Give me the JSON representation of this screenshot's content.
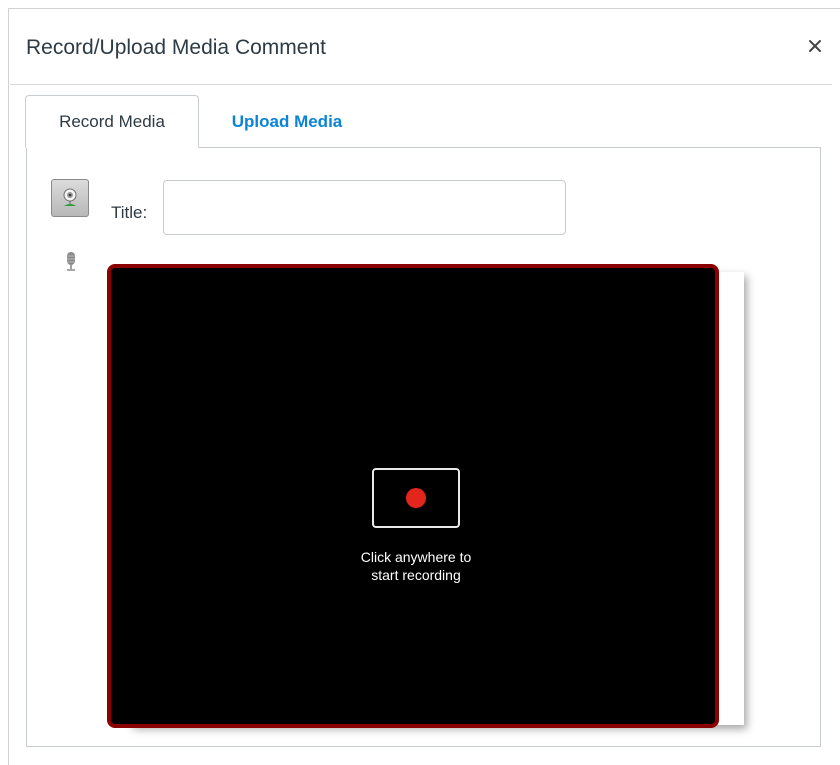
{
  "dialog": {
    "title": "Record/Upload Media Comment",
    "close_label": "×",
    "colors": {
      "title_text": "#2d3b45",
      "link_blue": "#0b84d6",
      "record_red": "#e3261b",
      "recorder_border": "#8b0000"
    }
  },
  "tabs": [
    {
      "label": "Record Media",
      "active": true
    },
    {
      "label": "Upload Media",
      "active": false
    }
  ],
  "record": {
    "webcam_icon": "webcam-icon",
    "microphone_icon": "microphone-icon",
    "title_label": "Title:",
    "title_value": "",
    "hint_line1": "Click anywhere to",
    "hint_line2": "start recording"
  }
}
